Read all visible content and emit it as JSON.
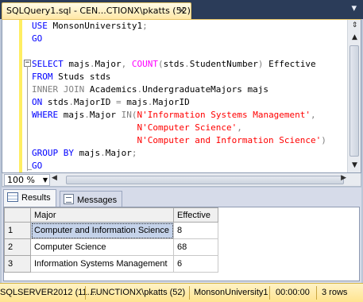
{
  "tab": {
    "title": "SQLQuery1.sql - CEN...CTIONX\\pkatts (52))*",
    "close": "×"
  },
  "window_close": "▾",
  "editor": {
    "lines": [
      [
        {
          "t": "USE ",
          "c": "kw"
        },
        {
          "t": "MonsonUniversity1",
          "c": "tx"
        },
        {
          "t": ";",
          "c": "gr"
        }
      ],
      [
        {
          "t": "GO",
          "c": "kw"
        }
      ],
      [],
      [
        {
          "t": "SELECT ",
          "c": "kw"
        },
        {
          "t": "majs",
          "c": "tx"
        },
        {
          "t": ".",
          "c": "gr"
        },
        {
          "t": "Major",
          "c": "tx"
        },
        {
          "t": ", ",
          "c": "gr"
        },
        {
          "t": "COUNT",
          "c": "fn"
        },
        {
          "t": "(",
          "c": "gr"
        },
        {
          "t": "stds",
          "c": "tx"
        },
        {
          "t": ".",
          "c": "gr"
        },
        {
          "t": "StudentNumber",
          "c": "tx"
        },
        {
          "t": ") ",
          "c": "gr"
        },
        {
          "t": "Effective",
          "c": "tx"
        }
      ],
      [
        {
          "t": "FROM ",
          "c": "kw"
        },
        {
          "t": "Studs stds",
          "c": "tx"
        }
      ],
      [
        {
          "t": "INNER JOIN ",
          "c": "gr"
        },
        {
          "t": "Academics",
          "c": "tx"
        },
        {
          "t": ".",
          "c": "gr"
        },
        {
          "t": "UndergraduateMajors majs",
          "c": "tx"
        }
      ],
      [
        {
          "t": "ON ",
          "c": "kw"
        },
        {
          "t": "stds",
          "c": "tx"
        },
        {
          "t": ".",
          "c": "gr"
        },
        {
          "t": "MajorID ",
          "c": "tx"
        },
        {
          "t": "= ",
          "c": "gr"
        },
        {
          "t": "majs",
          "c": "tx"
        },
        {
          "t": ".",
          "c": "gr"
        },
        {
          "t": "MajorID",
          "c": "tx"
        }
      ],
      [
        {
          "t": "WHERE ",
          "c": "kw"
        },
        {
          "t": "majs",
          "c": "tx"
        },
        {
          "t": ".",
          "c": "gr"
        },
        {
          "t": "Major ",
          "c": "tx"
        },
        {
          "t": "IN",
          "c": "gr"
        },
        {
          "t": "(",
          "c": "gr"
        },
        {
          "t": "N'Information Systems Management'",
          "c": "str"
        },
        {
          "t": ",",
          "c": "gr"
        }
      ],
      [
        {
          "t": "                    ",
          "c": "tx"
        },
        {
          "t": "N'Computer Science'",
          "c": "str"
        },
        {
          "t": ",",
          "c": "gr"
        }
      ],
      [
        {
          "t": "                    ",
          "c": "tx"
        },
        {
          "t": "N'Computer and Information Science'",
          "c": "str"
        },
        {
          "t": ")",
          "c": "gr"
        }
      ],
      [
        {
          "t": "GROUP BY ",
          "c": "kw"
        },
        {
          "t": "majs",
          "c": "tx"
        },
        {
          "t": ".",
          "c": "gr"
        },
        {
          "t": "Major",
          "c": "tx"
        },
        {
          "t": ";",
          "c": "gr"
        }
      ],
      [
        {
          "t": "GO",
          "c": "kw"
        }
      ]
    ]
  },
  "zoom": {
    "value": "100 %"
  },
  "results_tabs": {
    "results": "Results",
    "messages": "Messages"
  },
  "grid": {
    "columns": [
      "Major",
      "Effective"
    ],
    "rows": [
      {
        "n": "1",
        "major": "Computer and Information Science",
        "effective": "8"
      },
      {
        "n": "2",
        "major": "Computer Science",
        "effective": "68"
      },
      {
        "n": "3",
        "major": "Information Systems Management",
        "effective": "6"
      }
    ]
  },
  "status": {
    "server": "SQLSERVER2012 (11....",
    "user": "FUNCTIONX\\pkatts (52)",
    "database": "MonsonUniversity1",
    "time": "00:00:00",
    "rows": "3 rows"
  }
}
